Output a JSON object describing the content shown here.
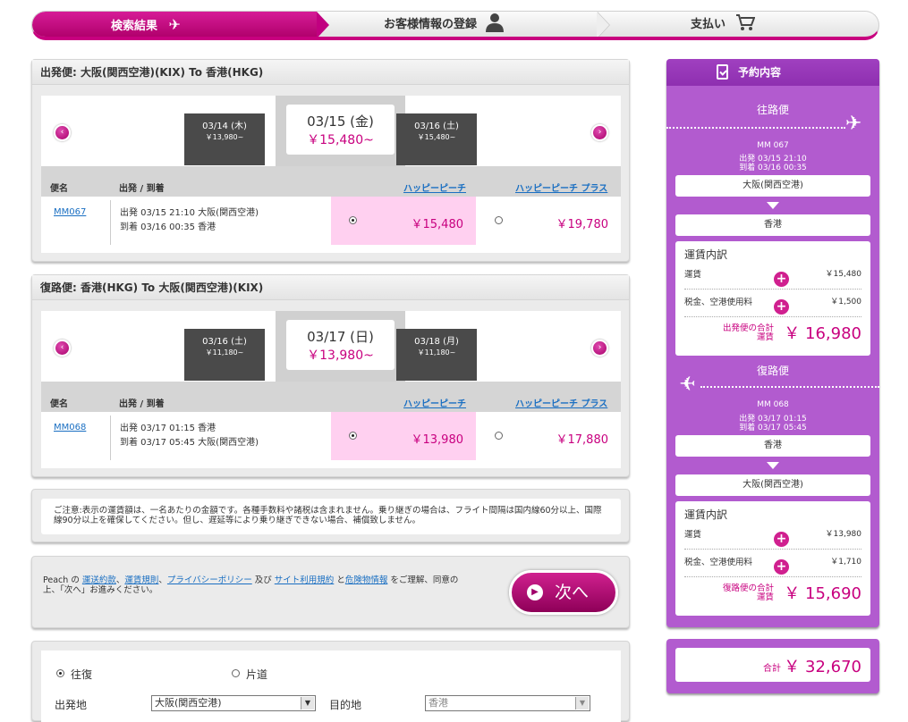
{
  "steps": {
    "step1": "検索結果",
    "step2": "お客様情報の登録",
    "step3": "支払い"
  },
  "outbound": {
    "title": "出発便:  大阪(関西空港)(KIX)  To  香港(HKG)",
    "prev_date": {
      "date": "03/14 (木)",
      "price": "￥13,980~"
    },
    "sel_date": {
      "date": "03/15 (金)",
      "price": "￥15,480~"
    },
    "next_date": {
      "date": "03/16 (土)",
      "price": "￥15,480~"
    },
    "col_flight": "便名",
    "col_deparr": "出発 / 到着",
    "col_fare1": "ハッピーピーチ",
    "col_fare2": "ハッピーピーチ プラス",
    "flight_no": "MM067",
    "dep": "出発  03/15  21:10  大阪(関西空港)",
    "arr": "到着  03/16  00:35  香港",
    "price1": "￥15,480",
    "price2": "￥19,780"
  },
  "inbound": {
    "title": "復路便:  香港(HKG)  To  大阪(関西空港)(KIX)",
    "prev_date": {
      "date": "03/16 (土)",
      "price": "￥11,180~"
    },
    "sel_date": {
      "date": "03/17 (日)",
      "price": "￥13,980~"
    },
    "next_date": {
      "date": "03/18 (月)",
      "price": "￥11,180~"
    },
    "col_flight": "便名",
    "col_deparr": "出発 / 到着",
    "col_fare1": "ハッピーピーチ",
    "col_fare2": "ハッピーピーチ プラス",
    "flight_no": "MM068",
    "dep": "出発  03/17  01:15  香港",
    "arr": "到着  03/17  05:45  大阪(関西空港)",
    "price1": "￥13,980",
    "price2": "￥17,880"
  },
  "notice": "ご注意:表示の運賃額は、一名あたりの金額です。各種手数料や諸税は含まれません。乗り継ぎの場合は、フライト間隔は国内線60分以上、国際線90分以上を確保してください。但し、遅延等により乗り継ぎできない場合、補償致しません。",
  "agree": {
    "pre": "Peach の",
    "link1": "運送約款",
    "sep1": "、",
    "link2": "運賃規則",
    "sep2": "、",
    "link3": "プライバシーポリシー",
    "mid": " 及び ",
    "link4": "サイト利用規約",
    "mid2": " と",
    "link5": "危険物情報",
    "post": " をご理解、同意の上、「次へ」お進みください。",
    "next_label": "次へ"
  },
  "search": {
    "round_trip": "往復",
    "one_way": "片道",
    "origin_label": "出発地",
    "origin_value": "大阪(関西空港)",
    "dest_label": "目的地",
    "dest_value": "香港"
  },
  "summary": {
    "header": "予約内容",
    "out_label": "往路便",
    "out_flight": "MM 067",
    "out_dep": "出発  03/15  21:10",
    "out_arr": "到着  03/16  00:35",
    "out_from": "大阪(関西空港)",
    "out_to": "香港",
    "fare_title": "運賃内訳",
    "fare_label": "運賃",
    "tax_label": "税金、空港使用料",
    "out_fare": "￥15,480",
    "out_tax": "￥1,500",
    "out_total_label": "出発便の合計運賃",
    "out_total": "￥ 16,980",
    "in_label": "復路便",
    "in_flight": "MM 068",
    "in_dep": "出発  03/17  01:15",
    "in_arr": "到着  03/17  05:45",
    "in_from": "香港",
    "in_to": "大阪(関西空港)",
    "in_fare": "￥13,980",
    "in_tax": "￥1,710",
    "in_total_label": "復路便の合計運賃",
    "in_total": "￥ 15,690",
    "grand_label": "合計",
    "grand_total": "￥ 32,670"
  }
}
